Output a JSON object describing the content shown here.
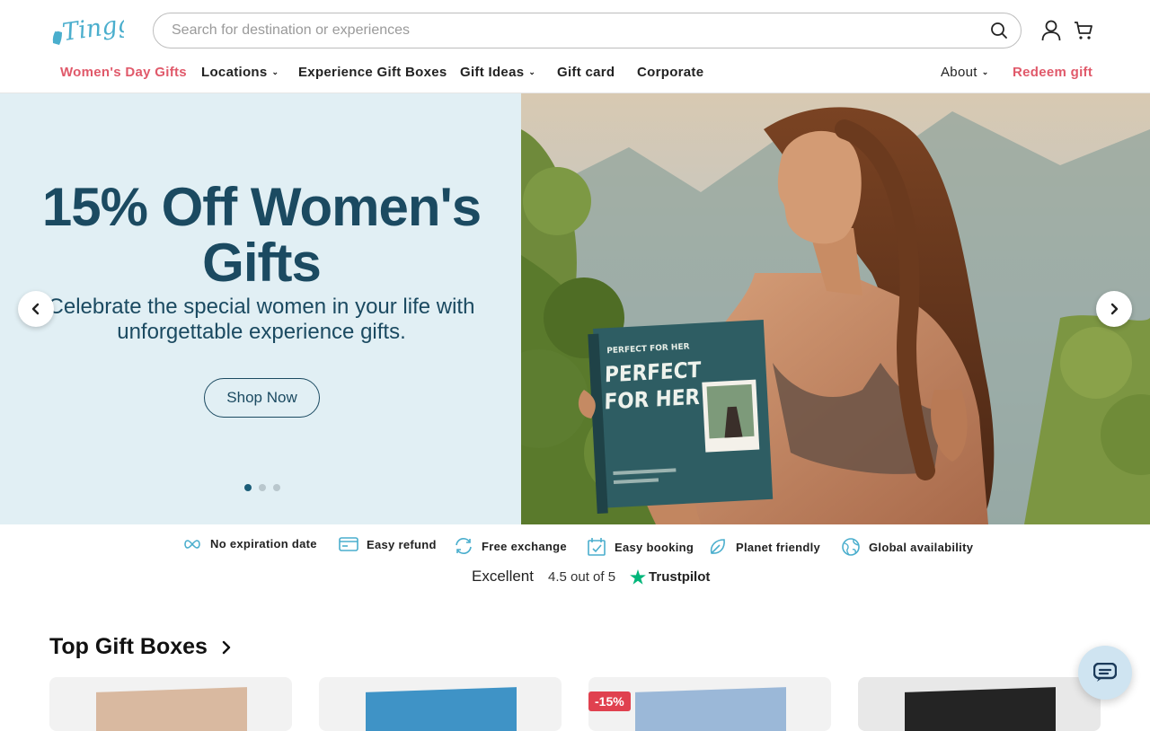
{
  "brand": {
    "logo_text": "Tinggly",
    "accent": "#4aaecd",
    "pink": "#e0596a",
    "navy": "#1b4a61"
  },
  "search": {
    "placeholder": "Search for destination or experiences"
  },
  "nav": {
    "womens_day": "Women's Day Gifts",
    "locations": "Locations",
    "experience_boxes": "Experience Gift Boxes",
    "gift_ideas": "Gift Ideas",
    "gift_card": "Gift card",
    "corporate": "Corporate",
    "about": "About",
    "redeem": "Redeem gift"
  },
  "hero": {
    "title": "15% Off Women's Gifts",
    "subtitle": "Celebrate the special women in your life with unforgettable experience gifts.",
    "cta": "Shop Now",
    "slides": 3,
    "active_slide": 1,
    "box_text_line1": "PERFECT",
    "box_text_line2": "FOR HER",
    "box_header": "PERFECT FOR HER"
  },
  "usps": [
    {
      "label": "No expiration date",
      "icon": "infinity-icon"
    },
    {
      "label": "Easy refund",
      "icon": "card-icon"
    },
    {
      "label": "Free exchange",
      "icon": "exchange-icon"
    },
    {
      "label": "Easy booking",
      "icon": "calendar-check-icon"
    },
    {
      "label": "Planet friendly",
      "icon": "leaf-icon"
    },
    {
      "label": "Global availability",
      "icon": "globe-icon"
    }
  ],
  "trustpilot": {
    "rating_word": "Excellent",
    "score_text": "4.5 out of 5",
    "brand": "Trustpilot",
    "star_color": "#00b67a"
  },
  "top_gift_boxes": {
    "title": "Top Gift Boxes",
    "discount_badge": "-15%"
  }
}
